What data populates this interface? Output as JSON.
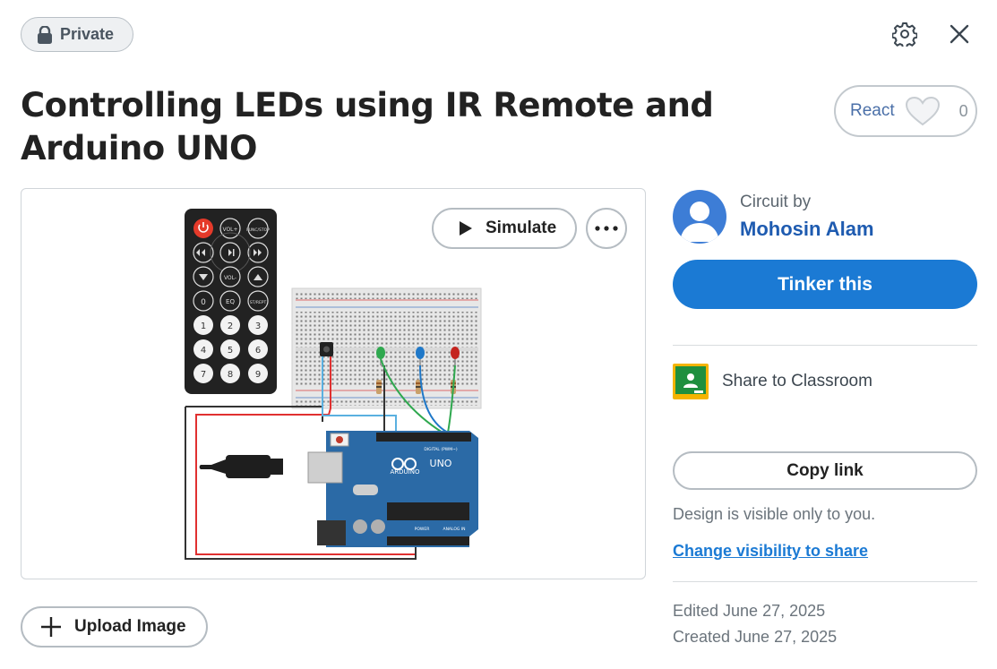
{
  "header": {
    "privacy_label": "Private",
    "icons": {
      "privacy": "lock-icon",
      "settings": "gear-icon",
      "close": "close-icon"
    }
  },
  "design": {
    "title_line1": "Controlling LEDs using IR Remote and",
    "title_line2": "Arduino UNO"
  },
  "react": {
    "label": "React",
    "count": "0",
    "icon": "heart-icon"
  },
  "preview": {
    "simulate_label": "Simulate",
    "more_icon": "more-icon",
    "board": {
      "remote_buttons": [
        "VOL+",
        "FUNC/STOP",
        "VOL-",
        "EQ",
        "ST/REPT",
        "0",
        "1",
        "2",
        "3",
        "4",
        "5",
        "6",
        "7",
        "8",
        "9"
      ],
      "arduino_label": "UNO",
      "arduino_brand": "ARDUINO",
      "digital_label": "DIGITAL (PWM~)",
      "power_label": "POWER",
      "analog_label": "ANALOG IN",
      "led_colors": [
        "#2fa84f",
        "#1f78c8",
        "#c4251f"
      ]
    }
  },
  "upload": {
    "label": "Upload Image"
  },
  "author": {
    "caption": "Circuit by",
    "name": "Mohosin Alam"
  },
  "actions": {
    "tinker_label": "Tinker this",
    "classroom_label": "Share to Classroom",
    "copy_label": "Copy link",
    "visibility_note": "Design is visible only to you.",
    "visibility_link": "Change visibility to share"
  },
  "meta": {
    "edited": "Edited June 27, 2025",
    "created": "Created June 27, 2025"
  },
  "colors": {
    "accent": "#1b7ad4",
    "author_link": "#1e5bb0",
    "classroom_green": "#1f8f3e",
    "classroom_yellow": "#f4b400"
  }
}
